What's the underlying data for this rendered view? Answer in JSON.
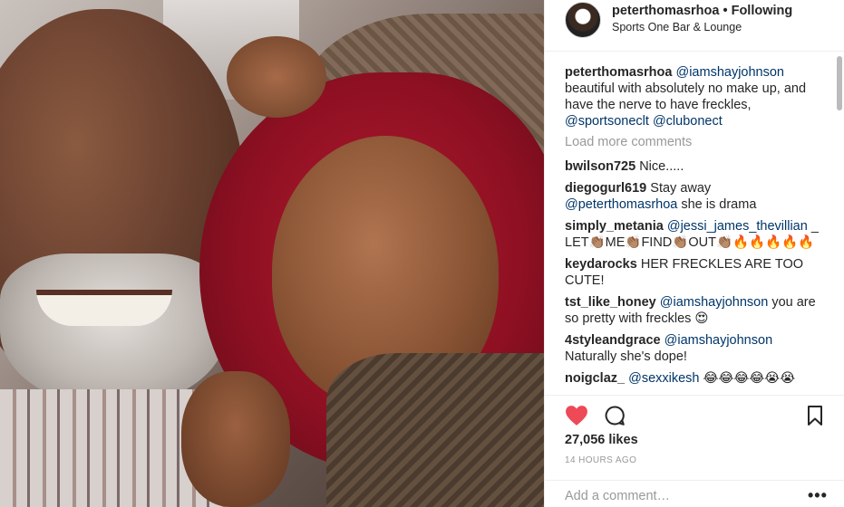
{
  "post": {
    "username": "peterthomasrhoa",
    "separator": "•",
    "follow_status": "Following",
    "location": "Sports One Bar & Lounge"
  },
  "caption": {
    "username": "peterthomasrhoa",
    "mention": "@iamshayjohnson",
    "text": " beautiful with absolutely no make up, and have the nerve to have freckles, ",
    "tag1": "@sportsoneclt",
    "tag2": "@clubonect"
  },
  "load_more": "Load more comments",
  "comments": [
    {
      "user": "bwilson725",
      "mention": "",
      "text": " Nice....."
    },
    {
      "user": "diegogurl619",
      "mention": "",
      "text": " Stay away ",
      "mention2": "@peterthomasrhoa",
      "text2": " she is drama"
    },
    {
      "user": "simply_metania",
      "mention": "@jessi_james_thevillian",
      "text": " _ LET👏🏽ME👏🏽FIND👏🏽OUT👏🏽🔥🔥🔥🔥🔥"
    },
    {
      "user": "keydarocks",
      "mention": "",
      "text": " HER FRECKLES ARE TOO CUTE!"
    },
    {
      "user": "tst_like_honey",
      "mention": "@iamshayjohnson",
      "text": " you are so pretty with freckles 😍"
    },
    {
      "user": "4styleandgrace",
      "mention": "@iamshayjohnson",
      "text": " Naturally she's dope!"
    },
    {
      "user": "noigclaz_",
      "mention": "@sexxikesh",
      "text": " 😂😂😂😂😭😭"
    }
  ],
  "likes": "27,056 likes",
  "time_ago": "14 HOURS AGO",
  "add_comment_placeholder": "Add a comment…",
  "more_label": "•••",
  "icons": {
    "like": "heart-icon",
    "comment": "comment-icon",
    "save": "bookmark-icon",
    "options": "more-options-icon"
  },
  "colors": {
    "like": "#ed4956",
    "mention": "#003569",
    "muted": "#999999"
  }
}
